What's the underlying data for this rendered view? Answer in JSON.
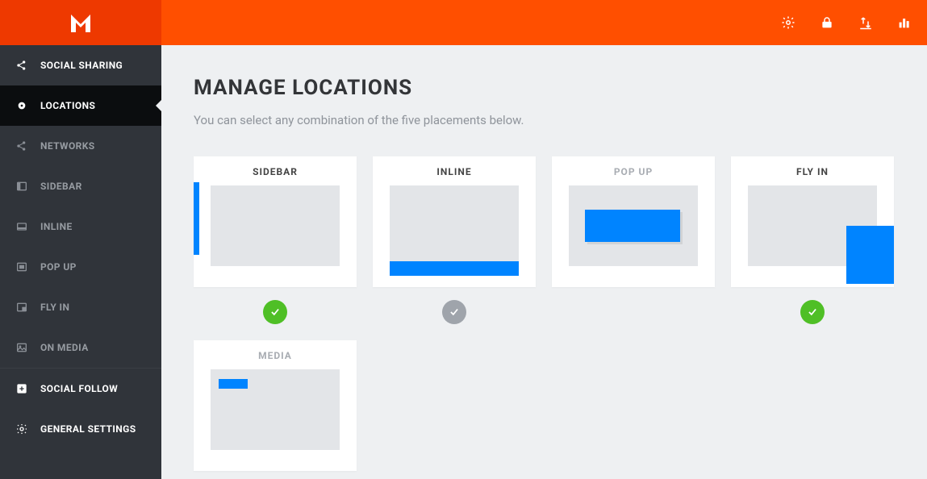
{
  "header": {
    "actions": [
      {
        "name": "settings-icon"
      },
      {
        "name": "lock-icon"
      },
      {
        "name": "import-export-icon"
      },
      {
        "name": "stats-icon"
      }
    ]
  },
  "sidebar": {
    "items": [
      {
        "label": "SOCIAL SHARING",
        "icon": "share-icon",
        "bright": true,
        "active": false
      },
      {
        "label": "LOCATIONS",
        "icon": "pin-icon",
        "bright": true,
        "active": true
      },
      {
        "label": "NETWORKS",
        "icon": "share-icon",
        "bright": false,
        "active": false
      },
      {
        "label": "SIDEBAR",
        "icon": "sidebar-icon",
        "bright": false,
        "active": false
      },
      {
        "label": "INLINE",
        "icon": "inline-icon",
        "bright": false,
        "active": false
      },
      {
        "label": "POP UP",
        "icon": "popup-icon",
        "bright": false,
        "active": false
      },
      {
        "label": "FLY IN",
        "icon": "flyin-icon",
        "bright": false,
        "active": false
      },
      {
        "label": "ON MEDIA",
        "icon": "image-icon",
        "bright": false,
        "active": false
      },
      {
        "label": "SOCIAL FOLLOW",
        "icon": "plus-icon",
        "bright": true,
        "active": false,
        "divider": true
      },
      {
        "label": "GENERAL SETTINGS",
        "icon": "gear-icon",
        "bright": true,
        "active": false
      }
    ]
  },
  "page": {
    "title": "MANAGE LOCATIONS",
    "subtitle": "You can select any combination of the five placements below."
  },
  "cards": [
    {
      "label": "SIDEBAR",
      "preview": "sidebar-pv",
      "status": "on",
      "name": "placement-sidebar"
    },
    {
      "label": "INLINE",
      "preview": "inline-pv",
      "status": "off",
      "name": "placement-inline"
    },
    {
      "label": "POP UP",
      "preview": "popup-pv",
      "status": "none",
      "name": "placement-popup",
      "disabled": true
    },
    {
      "label": "FLY IN",
      "preview": "flyin-pv",
      "status": "on",
      "name": "placement-flyin"
    },
    {
      "label": "MEDIA",
      "preview": "media-pv",
      "status": "none",
      "name": "placement-media",
      "disabled": true
    }
  ],
  "colors": {
    "brand_orange": "#ff4f00",
    "brand_orange_dark": "#ee3900",
    "accent_blue": "#0084ff",
    "status_on": "#4fbf26",
    "status_off": "#9fa4ab"
  }
}
